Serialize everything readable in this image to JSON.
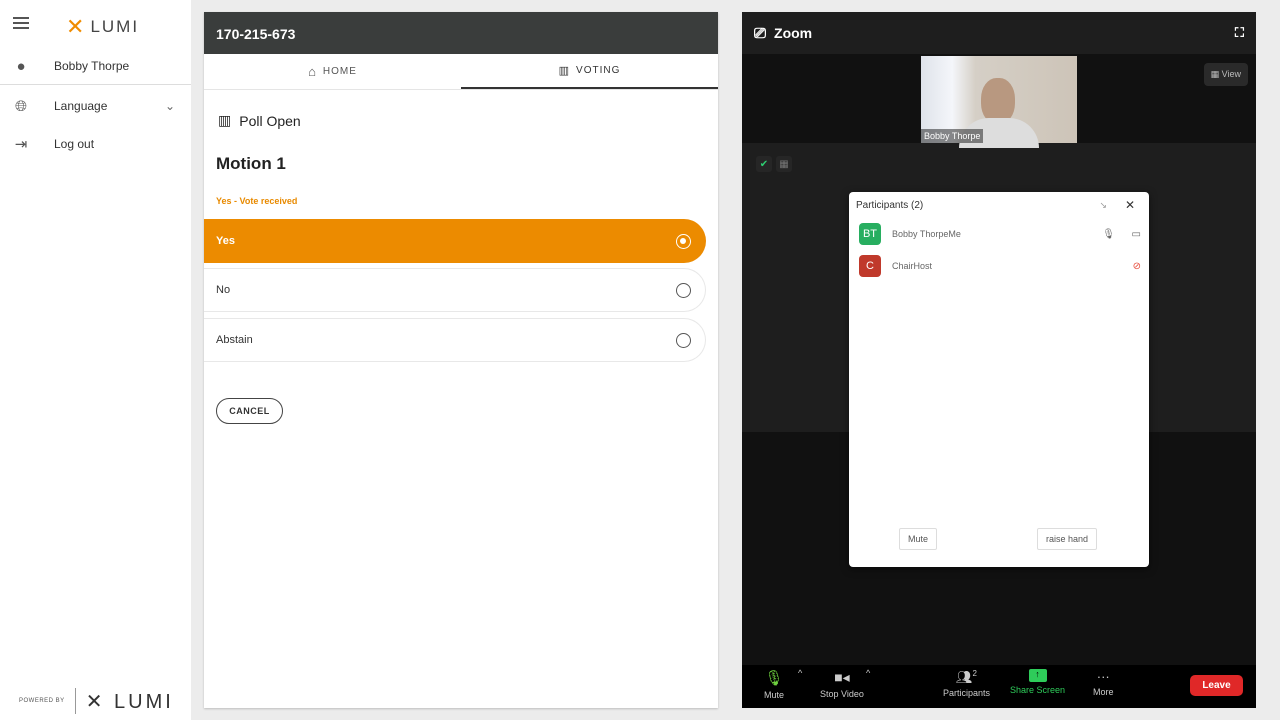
{
  "sidebar": {
    "brand": "LUMI",
    "user": "Bobby Thorpe",
    "language": "Language",
    "logout": "Log out",
    "powered_by": "POWERED BY",
    "powered_brand": "LUMI"
  },
  "panel": {
    "meeting_id": "170-215-673",
    "tabs": [
      {
        "label": "HOME"
      },
      {
        "label": "VOTING",
        "active": true
      }
    ],
    "poll_status": "Poll Open",
    "motion": "Motion 1",
    "vote_status": "Yes - Vote received",
    "options": [
      {
        "label": "Yes",
        "selected": true
      },
      {
        "label": "No",
        "selected": false
      },
      {
        "label": "Abstain",
        "selected": false
      }
    ],
    "cancel": "CANCEL",
    "accent": "#ec8b00"
  },
  "zoom": {
    "title": "Zoom",
    "camera_name": "Bobby Thorpe",
    "view": "View",
    "participants": {
      "title": "Participants (2)",
      "list": [
        {
          "initials": "BT",
          "name": "Bobby ThorpeMe",
          "color": "#27ae60"
        },
        {
          "initials": "C",
          "name": "ChairHost",
          "color": "#c0392b"
        }
      ],
      "mute": "Mute",
      "raise_hand": "raise hand"
    },
    "toolbar": {
      "mute": "Mute",
      "stop_video": "Stop Video",
      "participants": "Participants",
      "participants_count": "2",
      "share": "Share Screen",
      "more": "More",
      "leave": "Leave"
    }
  }
}
